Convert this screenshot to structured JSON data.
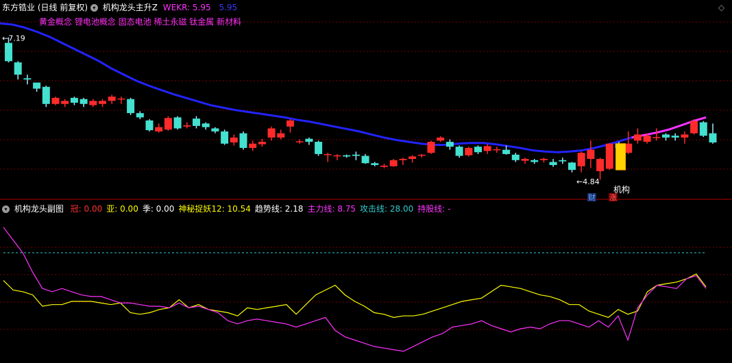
{
  "main_panel": {
    "stock_name": "东方锆业",
    "period": "(日线 前复权)",
    "indicator_name": "机构龙头主升Z",
    "wekr_label": "WEKR: 5.95",
    "wekr_value2": "5.95",
    "concepts": "黄金概念 锂电池概念 固态电池 稀土永磁 钛金属 新材料",
    "high_label": "7.19",
    "low_label": "4.84",
    "marker_cai": "财",
    "marker_zhang": "涨",
    "marker_jigou": "机构",
    "colors": {
      "up": "#ff2b2b",
      "down": "#44e0d0",
      "ma": "#2323ff",
      "ma_hot": "#ff33ff",
      "signal": "#ffd200",
      "grid": "#7a0000"
    }
  },
  "sub_panel": {
    "indicator_name": "机构龙头副图",
    "items": [
      {
        "label": "冠:",
        "value": "0.00",
        "color": "#ff3030"
      },
      {
        "label": "亚:",
        "value": "0.00",
        "color": "#ffff00"
      },
      {
        "label": "季:",
        "value": "0.00",
        "color": "#ffffff"
      },
      {
        "label": "神秘捉妖12:",
        "value": "10.54",
        "color": "#ffff00"
      },
      {
        "label": "趋势线:",
        "value": "2.18",
        "color": "#ffffff"
      },
      {
        "label": "主力线:",
        "value": "8.75",
        "color": "#ff33ff"
      },
      {
        "label": "攻击线:",
        "value": "28.00",
        "color": "#33cccc"
      },
      {
        "label": "持股线:",
        "value": "-",
        "color": "#ff33ff"
      }
    ]
  },
  "chart_data": [
    {
      "type": "candlestick",
      "ylim": [
        4.55,
        7.6
      ],
      "high_mark": 7.19,
      "low_mark": 4.84,
      "candles": [
        [
          7.1,
          6.8,
          7.19,
          6.78
        ],
        [
          6.78,
          6.58,
          6.8,
          6.5
        ],
        [
          6.52,
          6.5,
          6.58,
          6.42
        ],
        [
          6.45,
          6.35,
          6.45,
          6.3
        ],
        [
          6.38,
          6.1,
          6.4,
          6.05
        ],
        [
          6.1,
          6.2,
          6.22,
          6.08
        ],
        [
          6.1,
          6.15,
          6.18,
          6.05
        ],
        [
          6.2,
          6.12,
          6.22,
          6.08
        ],
        [
          6.18,
          6.1,
          6.2,
          6.05
        ],
        [
          6.08,
          6.15,
          6.18,
          6.05
        ],
        [
          6.1,
          6.15,
          6.18,
          6.05
        ],
        [
          6.15,
          6.22,
          6.25,
          6.1
        ],
        [
          6.18,
          6.18,
          6.22,
          6.1
        ],
        [
          6.18,
          5.95,
          6.2,
          5.92
        ],
        [
          5.95,
          5.88,
          5.98,
          5.85
        ],
        [
          5.83,
          5.67,
          5.85,
          5.65
        ],
        [
          5.65,
          5.72,
          5.78,
          5.63
        ],
        [
          5.68,
          5.87,
          5.9,
          5.66
        ],
        [
          5.88,
          5.7,
          5.9,
          5.68
        ],
        [
          5.73,
          5.75,
          5.8,
          5.7
        ],
        [
          5.86,
          5.74,
          5.9,
          5.7
        ],
        [
          5.78,
          5.72,
          5.8,
          5.68
        ],
        [
          5.7,
          5.65,
          5.72,
          5.62
        ],
        [
          5.65,
          5.45,
          5.68,
          5.43
        ],
        [
          5.47,
          5.55,
          5.6,
          5.42
        ],
        [
          5.62,
          5.38,
          5.65,
          5.35
        ],
        [
          5.38,
          5.45,
          5.5,
          5.33
        ],
        [
          5.44,
          5.48,
          5.53,
          5.4
        ],
        [
          5.55,
          5.7,
          5.73,
          5.5
        ],
        [
          5.55,
          5.62,
          5.68,
          5.52
        ],
        [
          5.73,
          5.83,
          5.85,
          5.63
        ],
        [
          5.48,
          5.48,
          5.52,
          5.45
        ],
        [
          5.53,
          5.48,
          5.55,
          5.43
        ],
        [
          5.48,
          5.28,
          5.5,
          5.25
        ],
        [
          5.27,
          5.27,
          5.3,
          5.15
        ],
        [
          5.25,
          5.25,
          5.28,
          5.18
        ],
        [
          5.26,
          5.24,
          5.27,
          5.22
        ],
        [
          5.27,
          5.25,
          5.32,
          5.18
        ],
        [
          5.25,
          5.13,
          5.28,
          5.12
        ],
        [
          5.13,
          5.1,
          5.15,
          5.08
        ],
        [
          5.07,
          5.09,
          5.12,
          5.05
        ],
        [
          5.08,
          5.18,
          5.2,
          5.07
        ],
        [
          5.18,
          5.2,
          5.22,
          5.1
        ],
        [
          5.2,
          5.24,
          5.26,
          5.14
        ],
        [
          5.25,
          5.26,
          5.28,
          5.22
        ],
        [
          5.3,
          5.48,
          5.5,
          5.28
        ],
        [
          5.5,
          5.55,
          5.57,
          5.48
        ],
        [
          5.48,
          5.4,
          5.52,
          5.35
        ],
        [
          5.4,
          5.25,
          5.42,
          5.22
        ],
        [
          5.26,
          5.38,
          5.4,
          5.24
        ],
        [
          5.4,
          5.31,
          5.42,
          5.28
        ],
        [
          5.33,
          5.41,
          5.44,
          5.28
        ],
        [
          5.35,
          5.35,
          5.4,
          5.3
        ],
        [
          5.35,
          5.28,
          5.42,
          5.27
        ],
        [
          5.27,
          5.18,
          5.3,
          5.15
        ],
        [
          5.17,
          5.2,
          5.22,
          5.12
        ],
        [
          5.18,
          5.15,
          5.2,
          5.12
        ],
        [
          5.18,
          5.2,
          5.22,
          5.14
        ],
        [
          5.15,
          5.1,
          5.2,
          5.07
        ],
        [
          5.18,
          5.16,
          5.22,
          5.12
        ],
        [
          5.14,
          5.02,
          5.15,
          4.98
        ],
        [
          5.08,
          5.3,
          5.32,
          4.98
        ],
        [
          5.2,
          5.35,
          5.5,
          5.05
        ],
        [
          5.0,
          5.2,
          5.22,
          4.86
        ],
        [
          5.04,
          5.45,
          5.46,
          5.02
        ],
        [
          5.45,
          5.38,
          5.48,
          5.33
        ],
        [
          5.3,
          5.45,
          5.65,
          5.28
        ],
        [
          5.5,
          5.6,
          5.7,
          5.45
        ],
        [
          5.48,
          5.58,
          5.62,
          5.45
        ],
        [
          5.55,
          5.55,
          5.7,
          5.5
        ],
        [
          5.6,
          5.55,
          5.62,
          5.5
        ],
        [
          5.58,
          5.55,
          5.62,
          5.5
        ],
        [
          5.55,
          5.6,
          5.65,
          5.45
        ],
        [
          5.62,
          5.82,
          5.85,
          5.6
        ],
        [
          5.8,
          5.58,
          5.82,
          5.56
        ],
        [
          5.62,
          5.47,
          5.78,
          5.45
        ]
      ],
      "signal_bar": {
        "index": 65,
        "open": 5.02,
        "close": 5.45
      },
      "ma": [
        7.42,
        7.4,
        7.35,
        7.28,
        7.2,
        7.1,
        7.0,
        6.9,
        6.8,
        6.68,
        6.58,
        6.48,
        6.4,
        6.33,
        6.26,
        6.2,
        6.14,
        6.08,
        6.04,
        6.0,
        5.97,
        5.94,
        5.91,
        5.88,
        5.84,
        5.81,
        5.77,
        5.73,
        5.69,
        5.65,
        5.6,
        5.55,
        5.51,
        5.48,
        5.45,
        5.43,
        5.43,
        5.45,
        5.46,
        5.46,
        5.44,
        5.41,
        5.38,
        5.34,
        5.32,
        5.31,
        5.32,
        5.34,
        5.38,
        5.43,
        5.49,
        5.55,
        5.59,
        5.63,
        5.68,
        5.75,
        5.82,
        5.88
      ]
    },
    {
      "type": "line",
      "series": [
        {
          "color": "#ffff00",
          "values": [
            17,
            11,
            10,
            8,
            1,
            2,
            2,
            4,
            4,
            4,
            3,
            2,
            3,
            -3,
            -4,
            -3,
            -1,
            0,
            5,
            0,
            2,
            -1,
            -2,
            -3,
            -5,
            0,
            -1,
            0,
            1,
            2,
            -4,
            2,
            8,
            11,
            14,
            8,
            4,
            1,
            -3,
            -4,
            -6,
            -5,
            -5,
            -4,
            -2,
            0,
            2,
            4,
            5,
            6,
            10,
            14,
            13,
            12,
            10,
            8,
            7,
            5,
            2,
            2,
            -2,
            -4,
            -6,
            -1,
            -4,
            -2,
            10,
            14,
            15,
            16,
            18,
            21,
            13
          ]
        },
        {
          "color": "#ff33ff",
          "values": [
            50,
            42,
            34,
            22,
            12,
            10,
            12,
            10,
            8,
            7,
            7,
            5,
            3,
            3,
            2,
            1,
            1,
            0,
            3,
            0,
            1,
            -1,
            -3,
            -8,
            -10,
            -8,
            -7,
            -8,
            -9,
            -10,
            -12,
            -10,
            -8,
            -6,
            -14,
            -18,
            -20,
            -22,
            -24,
            -25,
            -26,
            -27,
            -24,
            -21,
            -18,
            -16,
            -12,
            -11,
            -10,
            -8,
            -11,
            -13,
            -15,
            -13,
            -12,
            -13,
            -10,
            -8,
            -8,
            -10,
            -12,
            -8,
            -12,
            -5,
            -20,
            0,
            8,
            14,
            13,
            12,
            18,
            20,
            12
          ]
        }
      ],
      "reference_line": 28.0
    }
  ]
}
